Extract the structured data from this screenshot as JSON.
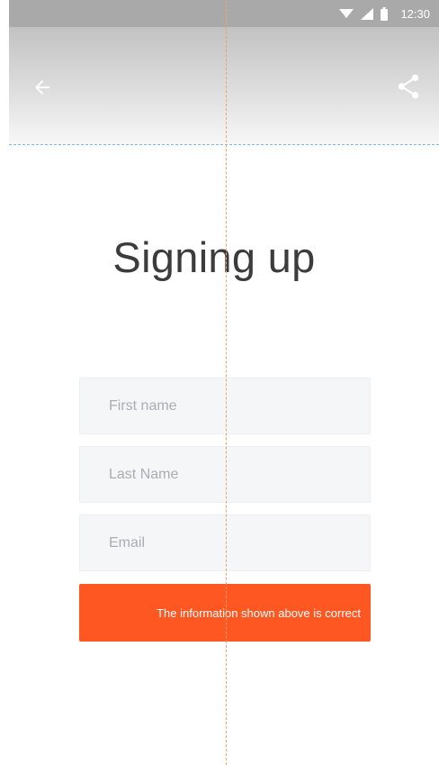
{
  "status_bar": {
    "time": "12:30",
    "icons": [
      "wifi-icon",
      "signal-icon",
      "battery-icon"
    ]
  },
  "toolbar": {
    "back_icon": "arrow-left-icon",
    "share_icon": "share-icon"
  },
  "page": {
    "title": "Signing up"
  },
  "form": {
    "first_name_placeholder": "First name",
    "last_name_placeholder": "Last Name",
    "email_placeholder": "Email",
    "confirm_label": "The information shown above is correct"
  },
  "colors": {
    "accent": "#ff5722",
    "status_bar": "#a9a9a9",
    "field_background": "#f5f6f8",
    "title_text": "#3c3c3c"
  }
}
